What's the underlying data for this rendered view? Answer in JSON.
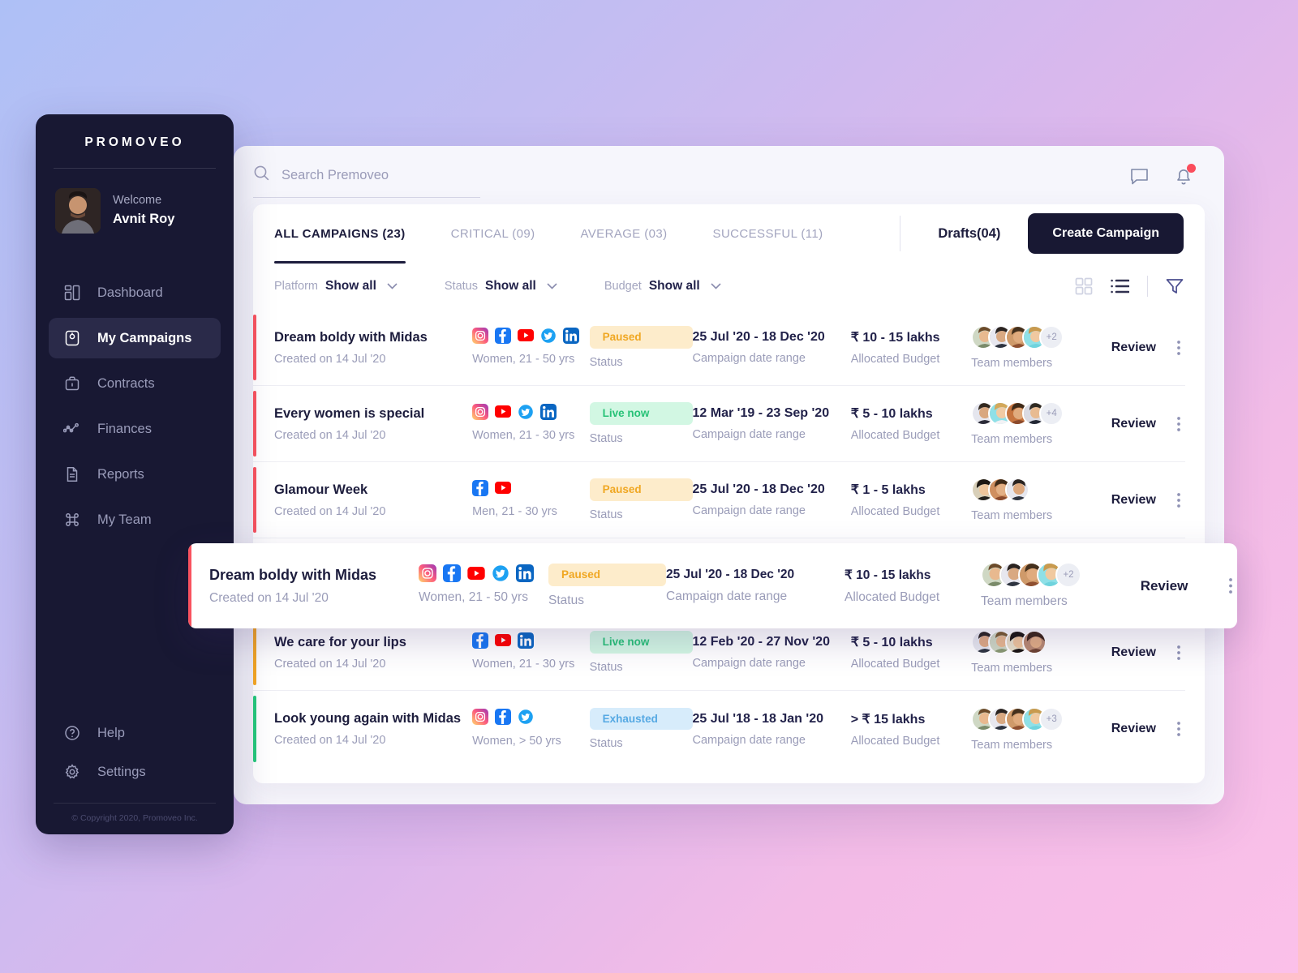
{
  "brand": "PROMOVEO",
  "profile": {
    "welcome": "Welcome",
    "name": "Avnit Roy"
  },
  "sidebar": {
    "items": [
      {
        "label": "Dashboard",
        "icon": "dashboard-icon",
        "active": false
      },
      {
        "label": "My Campaigns",
        "icon": "campaigns-icon",
        "active": true
      },
      {
        "label": "Contracts",
        "icon": "briefcase-icon",
        "active": false
      },
      {
        "label": "Finances",
        "icon": "chart-line-icon",
        "active": false
      },
      {
        "label": "Reports",
        "icon": "document-icon",
        "active": false
      },
      {
        "label": "My Team",
        "icon": "command-icon",
        "active": false
      }
    ],
    "bottom_items": [
      {
        "label": "Help",
        "icon": "help-circle-icon"
      },
      {
        "label": "Settings",
        "icon": "gear-icon"
      }
    ],
    "copyright": "© Copyright 2020, Promoveo Inc."
  },
  "topbar": {
    "search_placeholder": "Search Premoveo",
    "search_value": "",
    "search_icon": "search-icon",
    "chat_icon": "chat-bubble-icon",
    "bell_icon": "bell-icon"
  },
  "tabs": [
    {
      "label": "ALL CAMPAIGNS (23)",
      "active": true
    },
    {
      "label": "CRITICAL (09)",
      "active": false
    },
    {
      "label": "AVERAGE (03)",
      "active": false
    },
    {
      "label": "SUCCESSFUL (11)",
      "active": false
    }
  ],
  "drafts_label": "Drafts(04)",
  "create_button": "Create Campaign",
  "filters": [
    {
      "label": "Platform",
      "value": "Show all"
    },
    {
      "label": "Status",
      "value": "Show all"
    },
    {
      "label": "Budget",
      "value": "Show all"
    }
  ],
  "view_controls": [
    {
      "name": "grid-view-icon",
      "active": false
    },
    {
      "name": "list-view-icon",
      "active": true
    },
    {
      "name": "filter-funnel-icon",
      "active": false
    }
  ],
  "labels": {
    "status": "Status",
    "date_range": "Campaign date range",
    "budget": "Allocated Budget",
    "team": "Team members",
    "review": "Review",
    "kebab": "more-options-icon"
  },
  "colors": {
    "accent_dark": "#181833",
    "critical": "#f9525f",
    "average": "#f5a623",
    "successful": "#25c77b",
    "paused_text": "#f0a722",
    "paused_bg": "#fdeccb",
    "live_text": "#27c277",
    "live_bg": "#d2f7e3",
    "exhausted_text": "#56a9e3",
    "exhausted_bg": "#d7ecfb"
  },
  "campaigns": [
    {
      "title": "Dream boldy with Midas",
      "created": "Created on 14 Jul '20",
      "platforms": [
        "instagram",
        "facebook",
        "youtube",
        "twitter",
        "linkedin"
      ],
      "audience": "Women, 21 - 50 yrs",
      "status": "Paused",
      "status_kind": "paused",
      "date_range": "25 Jul '20 - 18 Dec '20",
      "budget": "₹ 10 - 15 lakhs",
      "team_avatars": 4,
      "team_extra": "+2",
      "bar_color": "#f9525f"
    },
    {
      "title": "Every women is special",
      "created": "Created on 14 Jul '20",
      "platforms": [
        "instagram",
        "youtube",
        "twitter",
        "linkedin"
      ],
      "audience": "Women, 21 - 30 yrs",
      "status": "Live now",
      "status_kind": "live",
      "date_range": "12 Mar '19 - 23 Sep '20",
      "budget": "₹ 5 - 10 lakhs",
      "team_avatars": 4,
      "team_extra": "+4",
      "bar_color": "#f9525f"
    },
    {
      "title": "Glamour Week",
      "created": "Created on 14 Jul '20",
      "platforms": [
        "facebook",
        "youtube"
      ],
      "audience": "Men, 21 - 30 yrs",
      "status": "Paused",
      "status_kind": "paused",
      "date_range": "25 Jul '20 - 18 Dec '20",
      "budget": "₹ 1 - 5 lakhs",
      "team_avatars": 3,
      "team_extra": "",
      "bar_color": "#f9525f"
    },
    {
      "title": "Dream boldy with Midas",
      "created": "Created on 14 Jul '20",
      "platforms": [
        "instagram",
        "facebook",
        "youtube",
        "twitter",
        "linkedin"
      ],
      "audience": "Women, 21 - 50 yrs",
      "status": "Paused",
      "status_kind": "paused",
      "date_range": "25 Jul '20 - 18 Dec '20",
      "budget": "₹ 10 - 15 lakhs",
      "team_avatars": 4,
      "team_extra": "+2",
      "bar_color": "#f9525f"
    },
    {
      "title": "We care for your lips",
      "created": "Created on 14 Jul '20",
      "platforms": [
        "facebook",
        "youtube",
        "linkedin"
      ],
      "audience": "Women, 21 - 30 yrs",
      "status": "Live now",
      "status_kind": "live",
      "date_range": "12 Feb '20 - 27 Nov '20",
      "budget": "₹ 5 - 10 lakhs",
      "team_avatars": 4,
      "team_extra": "",
      "bar_color": "#f5a623"
    },
    {
      "title": "Look young again with Midas",
      "created": "Created on 14 Jul '20",
      "platforms": [
        "instagram",
        "facebook",
        "twitter"
      ],
      "audience": "Women, > 50 yrs",
      "status": "Exhausted",
      "status_kind": "exhausted",
      "date_range": "25 Jul '18 - 18 Jan '20",
      "budget": "> ₹ 15 lakhs",
      "team_avatars": 4,
      "team_extra": "+3",
      "bar_color": "#25c77b"
    }
  ],
  "floating_card_index": 3
}
